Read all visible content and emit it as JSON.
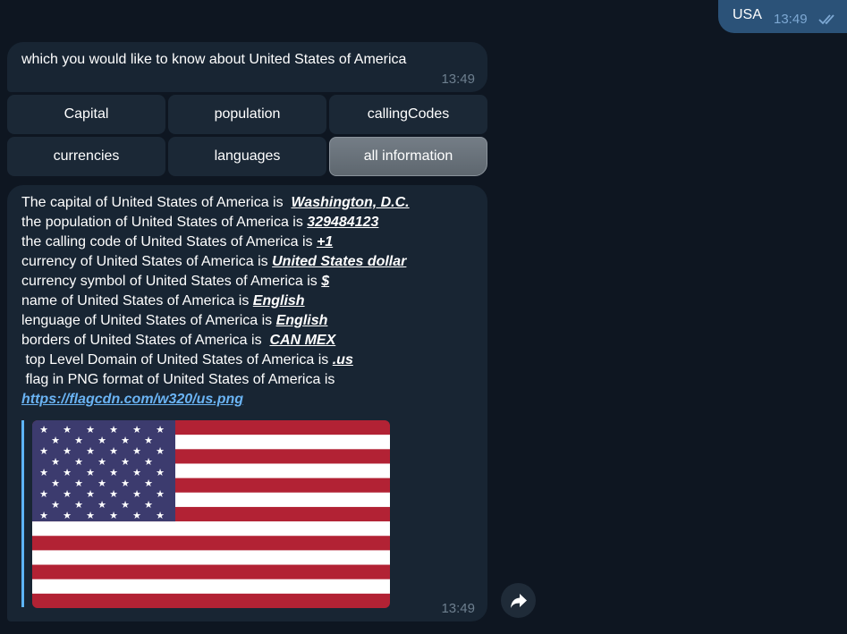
{
  "outgoing": {
    "text": "USA",
    "time": "13:49",
    "status_icon": "double-check-icon",
    "bubble_color": "#2b5278"
  },
  "prompt": {
    "text": "which you would like to know about United States of America",
    "time": "13:49"
  },
  "keyboard": {
    "row1": [
      "Capital",
      "population",
      "callingCodes"
    ],
    "row2": [
      "currencies",
      "languages",
      "all information"
    ]
  },
  "info": {
    "lines": [
      {
        "text": "The capital of United States of America is  ",
        "value": "Washington, D.C."
      },
      {
        "text": "the population of United States of America is ",
        "value": "329484123"
      },
      {
        "text": "the calling code of United States of America is ",
        "value": "+1"
      },
      {
        "text": "currency of United States of America is ",
        "value": "United States dollar"
      },
      {
        "text": "currency symbol of United States of America is ",
        "value": "$"
      },
      {
        "text": "name of United States of America is ",
        "value": "English"
      },
      {
        "text": "lenguage of United States of America is ",
        "value": "English"
      },
      {
        "text": "borders of United States of America is  ",
        "value": "CAN MEX"
      },
      {
        "text": " top Level Domain of United States of America is ",
        "value": ".us"
      },
      {
        "text": " flag in PNG format of United States of America is",
        "value": ""
      }
    ],
    "link": "https://flagcdn.com/w320/us.png",
    "time": "13:49",
    "link_color": "#6ab3f3"
  },
  "forward_icon": "share-arrow-icon"
}
